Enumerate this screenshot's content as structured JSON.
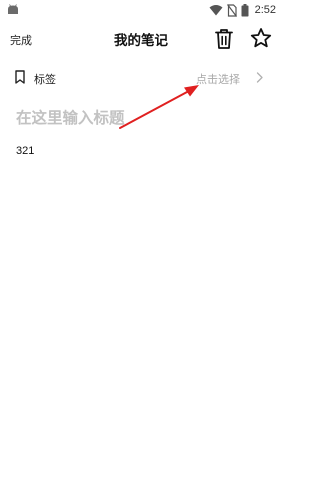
{
  "status_bar": {
    "time": "2:52",
    "icons": [
      "android-icon",
      "wifi-icon",
      "no-sim-icon",
      "battery-icon"
    ]
  },
  "header": {
    "done_label": "完成",
    "title": "我的笔记",
    "icons": [
      "trash-icon",
      "star-icon"
    ]
  },
  "tag_row": {
    "label": "标签",
    "value": "点击选择",
    "icons": [
      "bookmark-icon",
      "chevron-right-icon"
    ]
  },
  "note": {
    "title_placeholder": "在这里输入标题",
    "title_value": "",
    "body": "321"
  },
  "annotation": {
    "type": "red-arrow",
    "color": "#e02020",
    "points_to": "tag_row.value"
  },
  "colors": {
    "placeholder": "#c2c2c2",
    "hint_text": "#a8a8a8",
    "text": "#111111"
  }
}
